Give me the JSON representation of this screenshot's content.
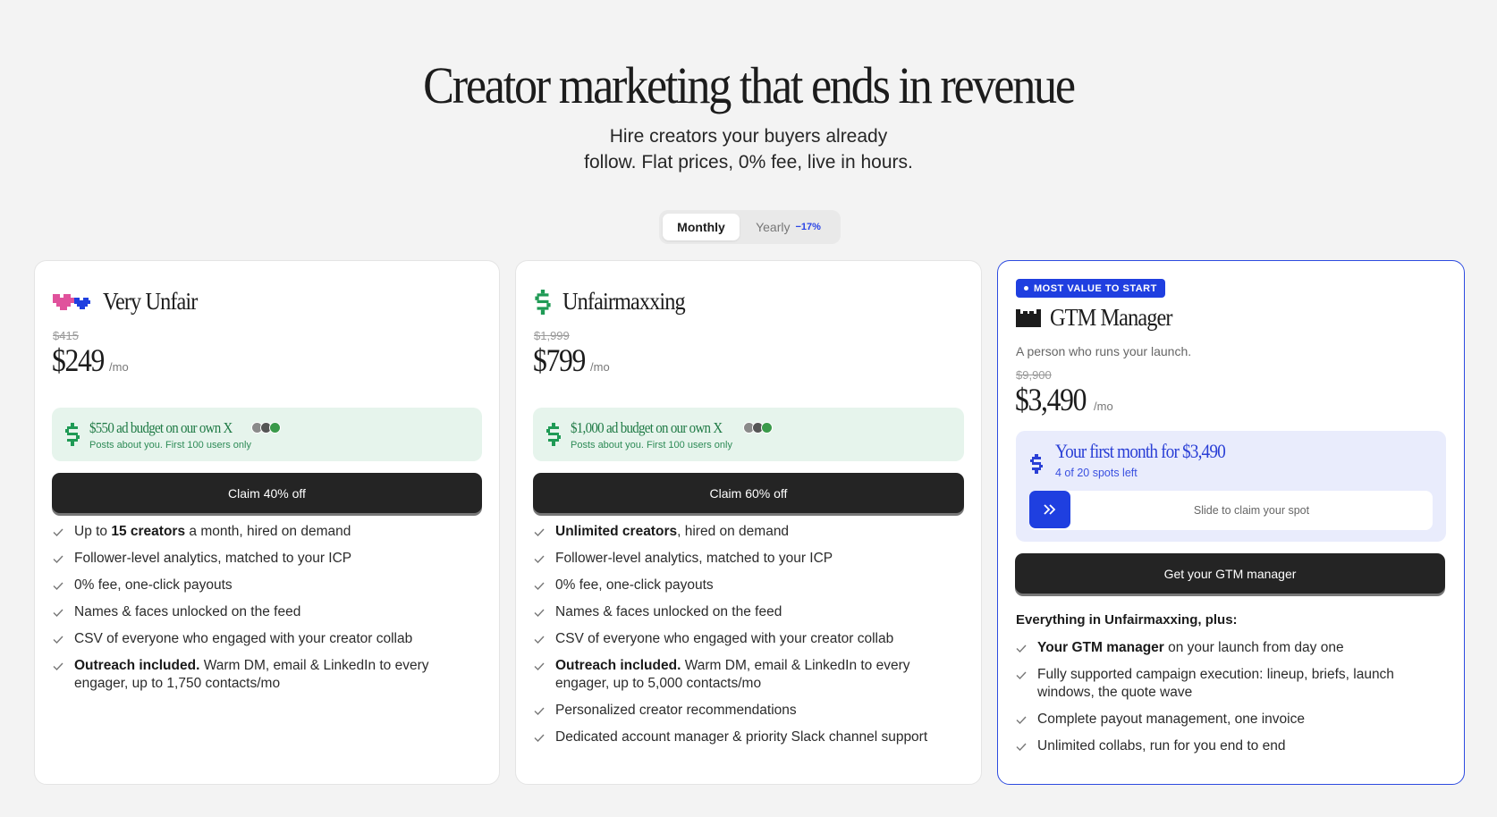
{
  "hero": {
    "title": "Creator marketing that ends in revenue",
    "subtitle_line1": "Hire creators your buyers already",
    "subtitle_line2": "follow. Flat prices, 0% fee, live in hours."
  },
  "billing_toggle": {
    "monthly_label": "Monthly",
    "yearly_label": "Yearly",
    "yearly_discount": "−17%",
    "selected": "Monthly"
  },
  "plans": [
    {
      "name": "Very Unfair",
      "icon": "pixel-hearts-icon",
      "old_price": "$415",
      "price": "$249",
      "period": "/mo",
      "budget_title": "$550 ad budget on our own X",
      "budget_sub": "Posts about you. First 100 users only",
      "cta": "Claim 40% off",
      "features": [
        {
          "bold": "",
          "pre": "Up to ",
          "mid": "15 creators",
          "post": " a month, hired on demand"
        },
        {
          "pre": "Follower-level analytics, matched to your ICP",
          "mid": "",
          "post": ""
        },
        {
          "pre": "0% fee, one-click payouts",
          "mid": "",
          "post": ""
        },
        {
          "pre": "Names & faces unlocked on the feed",
          "mid": "",
          "post": ""
        },
        {
          "pre": "CSV of everyone who engaged with your creator collab",
          "mid": "",
          "post": ""
        },
        {
          "pre": "",
          "mid": "Outreach included.",
          "post": " Warm DM, email & LinkedIn to every engager, up to 1,750 contacts/mo"
        }
      ]
    },
    {
      "name": "Unfairmaxxing",
      "icon": "dollar-icon",
      "old_price": "$1,999",
      "price": "$799",
      "period": "/mo",
      "budget_title": "$1,000 ad budget on our own X",
      "budget_sub": "Posts about you. First 100 users only",
      "cta": "Claim 60% off",
      "features": [
        {
          "pre": "",
          "mid": "Unlimited creators",
          "post": ", hired on demand"
        },
        {
          "pre": "Follower-level analytics, matched to your ICP",
          "mid": "",
          "post": ""
        },
        {
          "pre": "0% fee, one-click payouts",
          "mid": "",
          "post": ""
        },
        {
          "pre": "Names & faces unlocked on the feed",
          "mid": "",
          "post": ""
        },
        {
          "pre": "CSV of everyone who engaged with your creator collab",
          "mid": "",
          "post": ""
        },
        {
          "pre": "",
          "mid": "Outreach included.",
          "post": " Warm DM, email & LinkedIn to every engager, up to 5,000 contacts/mo"
        },
        {
          "pre": "Personalized creator recommendations",
          "mid": "",
          "post": ""
        },
        {
          "pre": "Dedicated account manager & priority Slack channel support",
          "mid": "",
          "post": ""
        }
      ]
    },
    {
      "badge": "MOST VALUE TO START",
      "name": "GTM Manager",
      "icon": "castle-icon",
      "tagline": "A person who runs your launch.",
      "old_price": "$9,900",
      "price": "$3,490",
      "period": "/mo",
      "offer_title": "Your first month for $3,490",
      "offer_sub": "4 of 20 spots left",
      "slider_label": "Slide to claim your spot",
      "cta": "Get your GTM manager",
      "plus_heading": "Everything in Unfairmaxxing, plus:",
      "features": [
        {
          "pre": "",
          "mid": "Your GTM manager",
          "post": " on your launch from day one"
        },
        {
          "pre": "Fully supported campaign execution: lineup, briefs, launch windows, the quote wave",
          "mid": "",
          "post": ""
        },
        {
          "pre": "Complete payout management, one invoice",
          "mid": "",
          "post": ""
        },
        {
          "pre": "Unlimited collabs, run for you end to end",
          "mid": "",
          "post": ""
        }
      ]
    }
  ],
  "colors": {
    "accent_blue": "#1f3fe0",
    "budget_green": "#1f7a45",
    "cta_dark": "#242424",
    "heart_pink": "#e0529c"
  }
}
